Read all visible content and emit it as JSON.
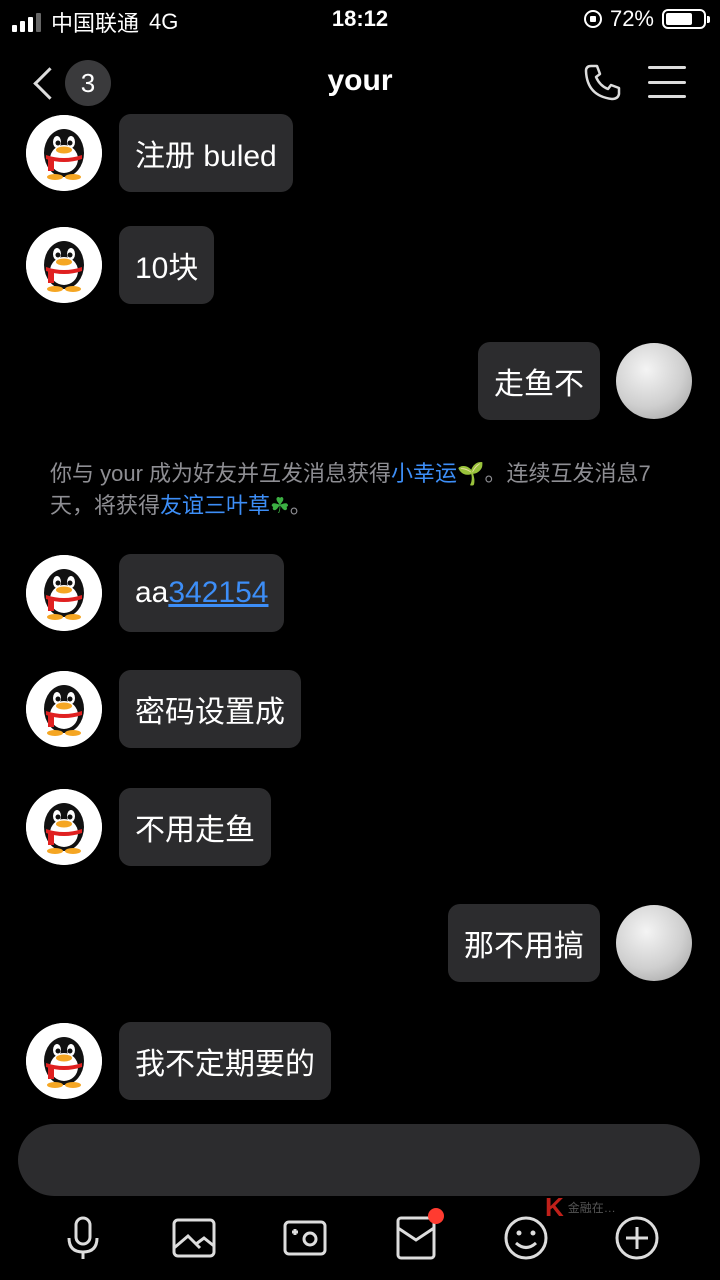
{
  "status_bar": {
    "carrier": "中国联通",
    "network": "4G",
    "time": "18:12",
    "battery": "72%",
    "battery_level": 0.72
  },
  "nav": {
    "back_badge": "3",
    "title": "your",
    "call_icon": "phone-icon",
    "menu_icon": "menu-icon"
  },
  "messages": [
    {
      "side": "left",
      "text": "注册 buled"
    },
    {
      "side": "left",
      "text": "10块"
    },
    {
      "side": "right",
      "text": "走鱼不"
    },
    {
      "side": "left",
      "text_prefix": "aa",
      "link": "342154"
    },
    {
      "side": "left",
      "text": "密码设置成"
    },
    {
      "side": "left",
      "text": "不用走鱼"
    },
    {
      "side": "right",
      "text": "那不用搞"
    },
    {
      "side": "left",
      "text": "我不定期要的"
    }
  ],
  "notice": {
    "part1": "你与 your 成为好友并互发消息获得",
    "hl1": "小幸运",
    "emoji1": "🌱",
    "part2": "。连续互发消息7天，将获得",
    "hl2": "友谊三叶草",
    "emoji2": "☘",
    "part3": "。"
  },
  "toolbar": {
    "icons": [
      "microphone-icon",
      "image-icon",
      "camera-icon",
      "red-packet-icon",
      "emoji-icon",
      "plus-icon"
    ]
  },
  "watermark": {
    "text": "金融在…"
  },
  "colors": {
    "background": "#000000",
    "bubble": "#2c2c2e",
    "link": "#3d8ef7",
    "badge_dot": "#ff3b30"
  }
}
